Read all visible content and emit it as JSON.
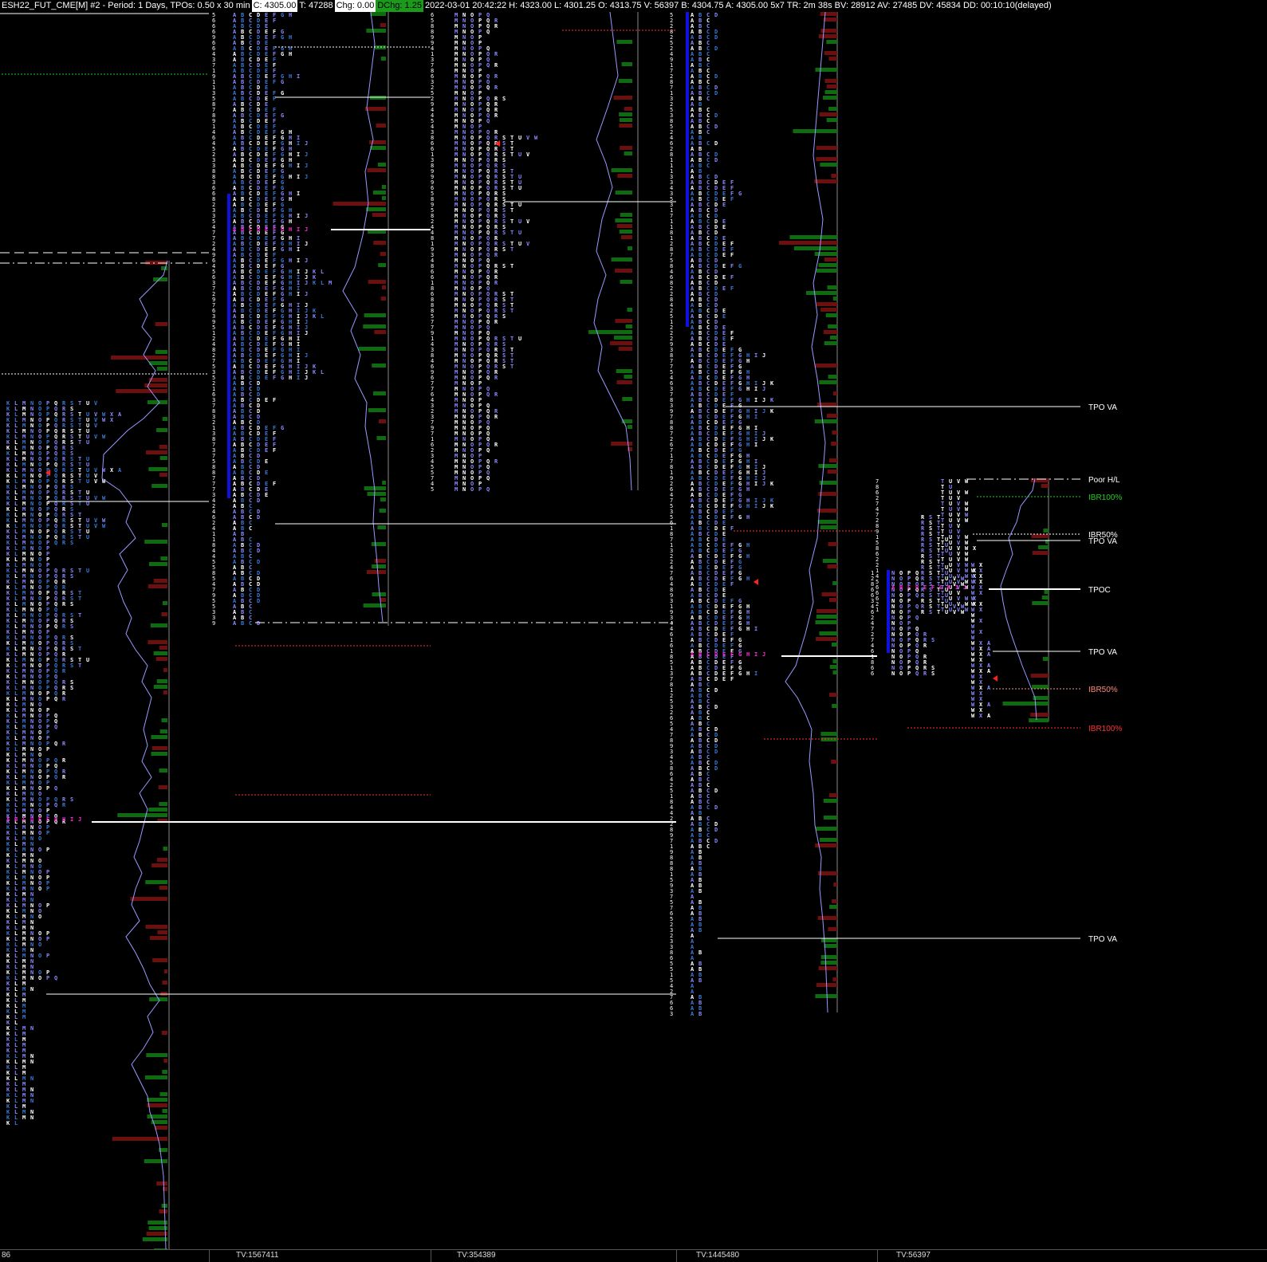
{
  "header": {
    "symbol_info": "ESH22_FUT_CME[M]  #2 - Period: 1 Days, TPOs: 0.50 x 30 min",
    "close": "C: 4305.00",
    "ticks": "T: 47288",
    "chg": "Chg: 0.00",
    "dchg": "DChg: 1.25",
    "details": "2022-03-01 20:42:22 H: 4323.00 L: 4301.25 O: 4313.75 V: 56397 B: 4304.75 A: 4305.00 5x7 TR: 2m 38s BV: 28912 AV: 27485 DV: 45834 DD: 00:10:10(delayed)"
  },
  "footer": {
    "left_value": "86",
    "sessions": [
      {
        "label": "TV:1567411"
      },
      {
        "label": "TV:354389"
      },
      {
        "label": "TV:1445480"
      },
      {
        "label": "TV:56397"
      }
    ]
  },
  "labels": {
    "tpo_va_1": "TPO VA",
    "poor_hl": "Poor H/L",
    "ibr100_green": "IBR100%",
    "ibr50_hidden": "IBR50%",
    "tpo_va_2": "TPO VA",
    "tpoc": "TPOC",
    "tpo_va_3": "TPO VA",
    "ibr50": "IBR50%",
    "ibr100_red": "IBR100%",
    "tpo_va_4": "TPO VA"
  },
  "colors": {
    "background": "#000000",
    "tpo_blue": "#3a7bd5",
    "tpo_light": "#8a8aff",
    "tpo_white": "#ffffff",
    "poc_magenta": "#ff2bd6",
    "value_area_bar": "#1010e0",
    "volume_green": "#0f6b0f",
    "volume_red": "#6b0f0f",
    "ib_green": "#22cc22",
    "ib_red": "#ff3333",
    "ib_salmon": "#ff8a7a",
    "profile_line": "#9a9aff"
  },
  "icons": {
    "marker": "red-triangle-left-icon"
  }
}
